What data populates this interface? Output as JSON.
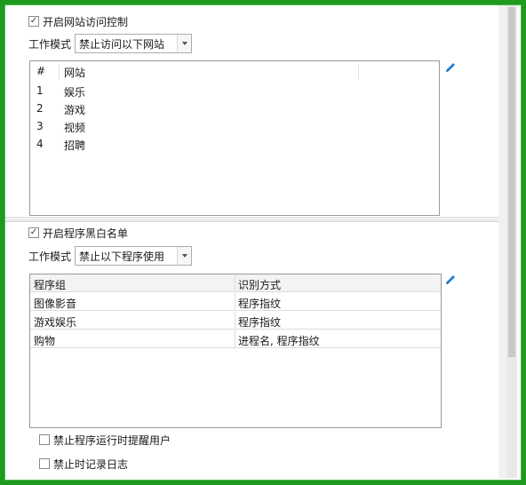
{
  "site_control": {
    "enable_label": "开启网站访问控制",
    "enabled": true,
    "mode_label": "工作模式",
    "mode_value": "禁止访问以下网站",
    "columns": [
      "#",
      "网站"
    ],
    "rows": [
      {
        "index": "1",
        "site": "娱乐"
      },
      {
        "index": "2",
        "site": "游戏"
      },
      {
        "index": "3",
        "site": "视频"
      },
      {
        "index": "4",
        "site": "招聘"
      }
    ],
    "edit_icon": "pencil-icon"
  },
  "program_blacklist": {
    "enable_label": "开启程序黑白名单",
    "enabled": true,
    "mode_label": "工作模式",
    "mode_value": "禁止以下程序使用",
    "columns": [
      "程序组",
      "识别方式"
    ],
    "rows": [
      {
        "group": "图像影音",
        "method": "程序指纹"
      },
      {
        "group": "游戏娱乐",
        "method": "程序指纹"
      },
      {
        "group": "购物",
        "method": "进程名, 程序指纹"
      }
    ],
    "edit_icon": "pencil-icon",
    "options": [
      {
        "label": "禁止程序运行时提醒用户",
        "checked": false
      },
      {
        "label": "禁止时记录日志",
        "checked": false
      }
    ]
  },
  "colors": {
    "frame_border": "#1e9a1e",
    "accent_icon": "#1f7fd1",
    "grid_header": "#f3f3f3"
  }
}
